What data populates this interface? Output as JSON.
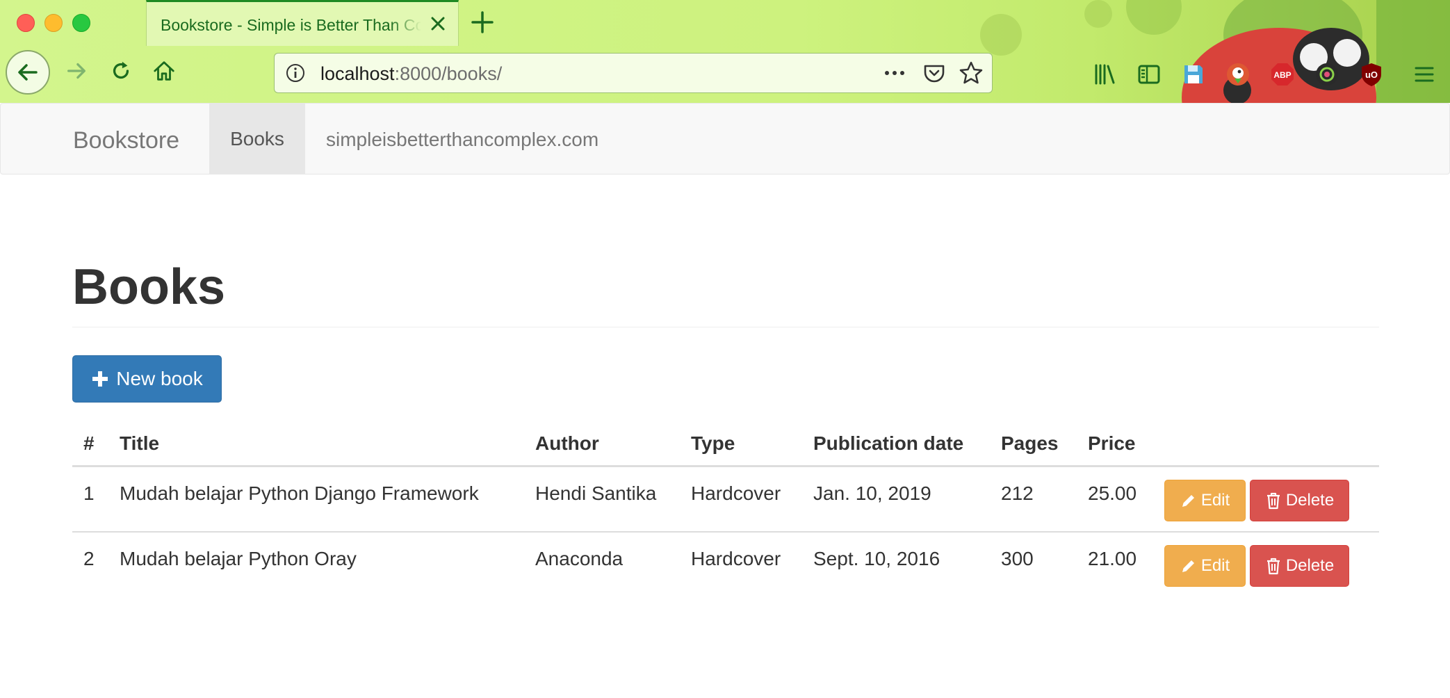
{
  "browser": {
    "tab_title": "Bookstore - Simple is Better Than Complex",
    "url_host": "localhost",
    "url_path": ":8000/books/",
    "icons": [
      "back-icon",
      "forward-icon",
      "reload-icon",
      "home-icon",
      "info-icon",
      "more-icon",
      "pocket-icon",
      "bookmark-star-icon",
      "library-icon",
      "sidebar-icon",
      "save-icon",
      "duckduckgo-icon",
      "adblock-plus-icon",
      "extension-icon",
      "ublock-icon",
      "menu-icon"
    ],
    "extension_labels": {
      "abp": "ABP",
      "ublock": "uO"
    }
  },
  "navbar": {
    "brand": "Bookstore",
    "active_item": "Books",
    "link": "simpleisbetterthancomplex.com"
  },
  "main": {
    "title": "Books",
    "new_button": "New book",
    "table": {
      "headers": [
        "#",
        "Title",
        "Author",
        "Type",
        "Publication date",
        "Pages",
        "Price"
      ],
      "rows": [
        [
          "1",
          "Mudah belajar Python Django Framework",
          "Hendi Santika",
          "Hardcover",
          "Jan. 10, 2019",
          "212",
          "25.00"
        ],
        [
          "2",
          "Mudah belajar Python Oray",
          "Anaconda",
          "Hardcover",
          "Sept. 10, 2016",
          "300",
          "21.00"
        ]
      ],
      "edit_label": "Edit",
      "delete_label": "Delete"
    }
  },
  "colors": {
    "primary": "#337ab7",
    "warning": "#f0ad4e",
    "danger": "#d9534f",
    "theme_green": "#1f8a23"
  }
}
